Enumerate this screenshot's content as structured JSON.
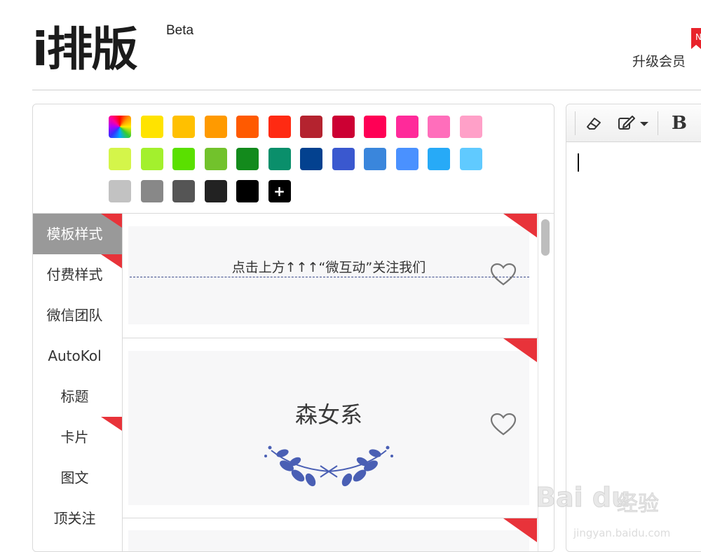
{
  "header": {
    "logo_text": "i排版",
    "logo_badge": "Beta",
    "upgrade_label": "升级会员",
    "new_badge": "N"
  },
  "palette": {
    "rows": [
      [
        "rainbow",
        "#ffe300",
        "#ffc000",
        "#ff9a00",
        "#ff5a00",
        "#ff2a12",
        "#b4232f",
        "#cc0033",
        "#ff0055",
        "#ff2a9a",
        "#ff6ebb",
        "#ffa0c8"
      ],
      [
        "#d4f54a",
        "#a3f02d",
        "#5ae000",
        "#72c22c",
        "#138a1c",
        "#0a8f6b",
        "#03418f",
        "#3a58cf",
        "#3a86dc",
        "#4a91ff",
        "#27aaf7",
        "#60caff"
      ],
      [
        "#c2c2c2",
        "#888888",
        "#555555",
        "#222222",
        "#000000",
        "add"
      ]
    ],
    "add_label": "+"
  },
  "nav": {
    "items": [
      {
        "label": "模板样式",
        "active": true
      },
      {
        "label": "付费样式",
        "active": false
      },
      {
        "label": "微信团队",
        "active": false
      },
      {
        "label": "AutoKol",
        "active": false
      },
      {
        "label": "标题",
        "active": false
      },
      {
        "label": "卡片",
        "active": false
      },
      {
        "label": "图文",
        "active": false
      },
      {
        "label": "顶关注",
        "active": false
      }
    ]
  },
  "templates": {
    "card1_text": "点击上方↑↑↑“微互动”关注我们",
    "card2_title": "森女系"
  },
  "editor": {
    "bold_label": "B"
  },
  "watermark": {
    "brand": "Bai du",
    "cn": "经验",
    "url": "jingyan.baidu.com"
  },
  "colors": {
    "accent_red": "#e8333a",
    "nav_active_bg": "#999999",
    "laurel_blue": "#4a5fb4"
  }
}
